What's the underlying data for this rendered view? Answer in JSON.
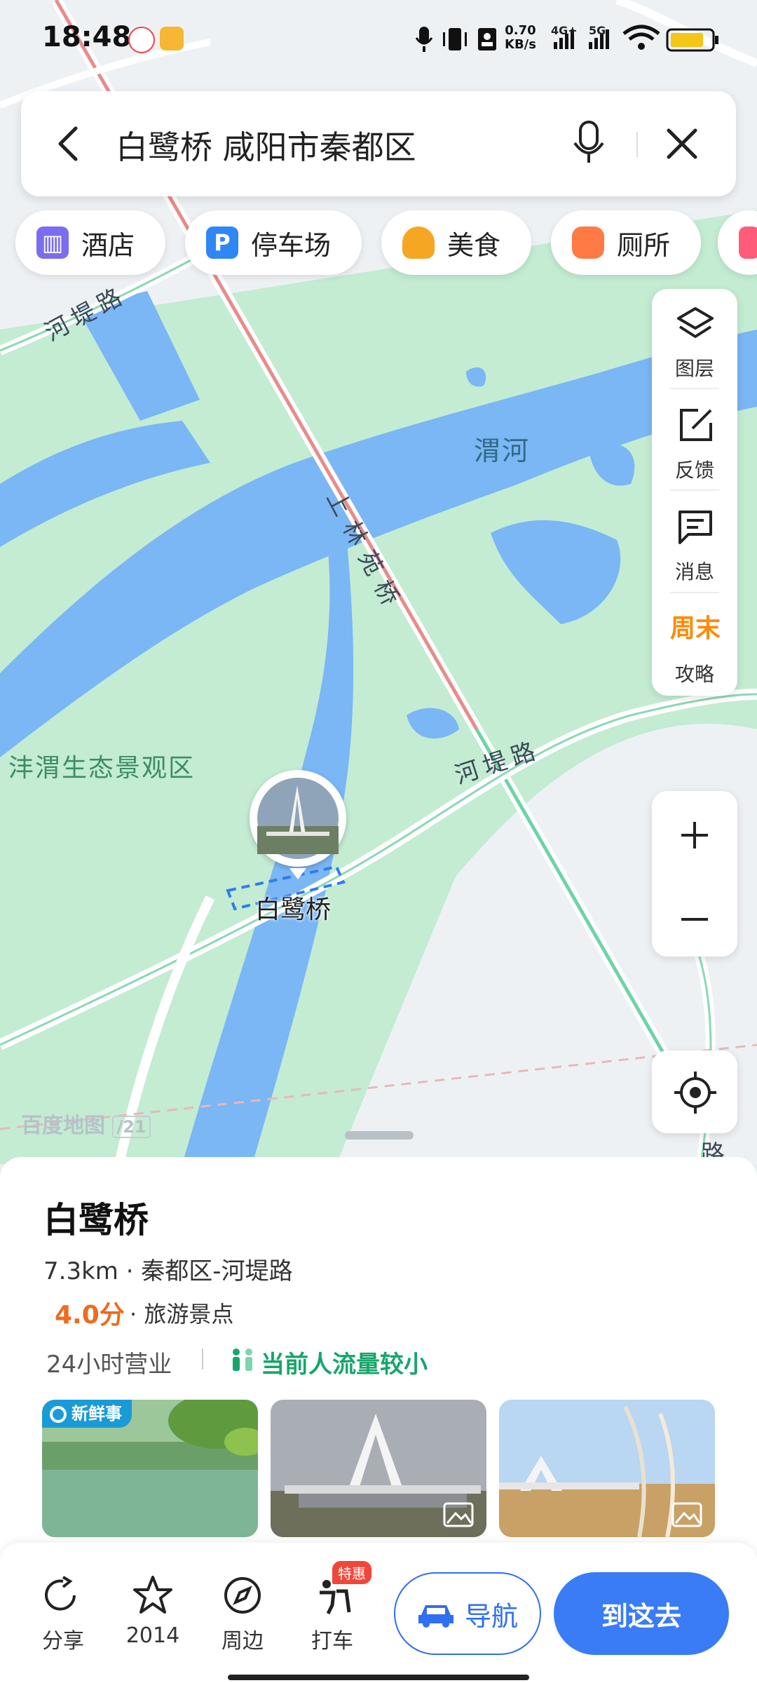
{
  "status_bar": {
    "time": "18:48",
    "speed_value": "0.70",
    "speed_unit": "KB/s",
    "net1": "4G+",
    "net2": "5G"
  },
  "search": {
    "query": "白鹭桥 咸阳市秦都区"
  },
  "chips": [
    {
      "label": "酒店",
      "icon": "hotel-icon",
      "color": "#7b6cf0"
    },
    {
      "label": "停车场",
      "icon": "parking-icon",
      "color": "#2f86f5"
    },
    {
      "label": "美食",
      "icon": "food-icon",
      "color": "#f5a623"
    },
    {
      "label": "厕所",
      "icon": "toilet-icon",
      "color": "#ff7a45"
    }
  ],
  "tools": {
    "layers": "图层",
    "feedback": "反馈",
    "messages": "消息",
    "weekend_badge": "周末",
    "guide": "攻略"
  },
  "map": {
    "labels": {
      "river": "渭河",
      "scenic": "沣渭生态景观区",
      "bridge_road": "上林苑桥",
      "dike_road_1": "河堤路",
      "dike_road_2": "河堤路",
      "poi": "白鹭桥",
      "edge_road": "路"
    },
    "watermark": "百度地图"
  },
  "place": {
    "name": "白鹭桥",
    "distance_address": "7.3km · 秦都区-河堤路",
    "rating": "4.0分",
    "type": "· 旅游景点",
    "hours": "24小时营业",
    "crowd": "当前人流量较小",
    "fresh_badge": "新鲜事"
  },
  "actions": {
    "share": "分享",
    "favorite_count": "2014",
    "nearby": "周边",
    "taxi": "打车",
    "taxi_promo": "特惠",
    "navigate": "导航",
    "go_here": "到这去"
  }
}
